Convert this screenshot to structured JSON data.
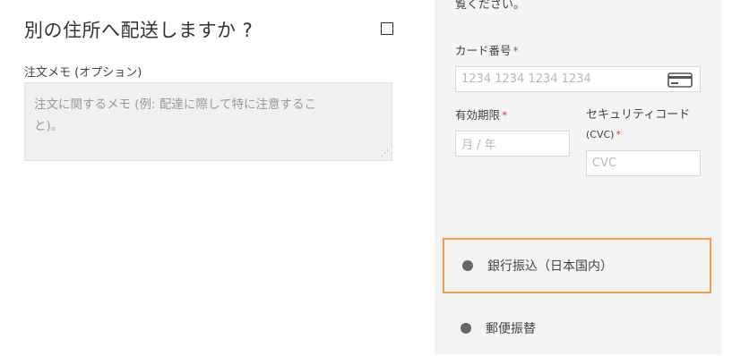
{
  "shipping": {
    "heading": "別の住所へ配送しますか ?"
  },
  "notes": {
    "label": "注文メモ (オプション)",
    "placeholder_line1": "注文に関するメモ (例: 配達に際して特に注意するこ",
    "placeholder_line2": "と)。"
  },
  "payment": {
    "intro": "覧ください。",
    "card_number_label": "カード番号",
    "card_number_placeholder": "1234 1234 1234 1234",
    "expiry_label": "有効期限",
    "expiry_placeholder": "月 / 年",
    "cvc_label_line1": "セキュリティコード",
    "cvc_label_line2": "(CVC)",
    "cvc_placeholder": "CVC",
    "required_mark": "*",
    "methods": [
      {
        "label": "銀行振込（日本国内）",
        "selected": true
      },
      {
        "label": "郵便振替",
        "selected": false
      }
    ]
  },
  "colors": {
    "accent": "#f0a04b",
    "required": "#e0462f",
    "panel_bg": "#f4f4f4"
  }
}
